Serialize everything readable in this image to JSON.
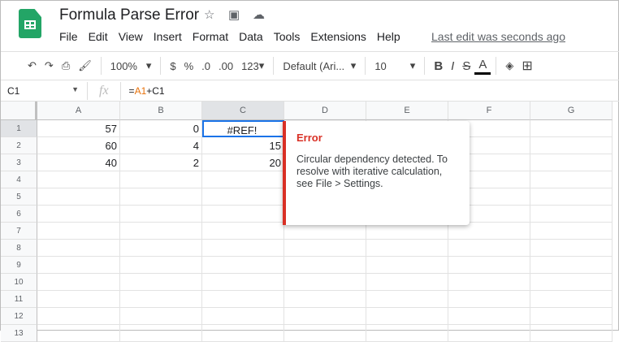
{
  "app": {
    "title": "Formula Parse Error",
    "last_edit": "Last edit was seconds ago"
  },
  "menu": [
    "File",
    "Edit",
    "View",
    "Insert",
    "Format",
    "Data",
    "Tools",
    "Extensions",
    "Help"
  ],
  "toolbar": {
    "zoom": "100%",
    "currency": "$",
    "percent": "%",
    "dec_less": ".0",
    "dec_more": ".00",
    "number_format": "123",
    "font": "Default (Ari...",
    "font_size": "10",
    "bold": "B",
    "italic": "I",
    "strike": "S",
    "text_color": "A"
  },
  "formula_bar": {
    "cell_ref": "C1",
    "fx": "fx",
    "formula_prefix": "=",
    "formula_ref1": "A1",
    "formula_rest": "+C1"
  },
  "columns": [
    "A",
    "B",
    "C",
    "D",
    "E",
    "F",
    "G"
  ],
  "rows": [
    "1",
    "2",
    "3",
    "4",
    "5",
    "6",
    "7",
    "8",
    "9",
    "10",
    "11",
    "12",
    "13"
  ],
  "cells": [
    [
      "57",
      "0",
      "#REF!"
    ],
    [
      "60",
      "4",
      "15"
    ],
    [
      "40",
      "2",
      "20"
    ]
  ],
  "error_popup": {
    "title": "Error",
    "message": "Circular dependency detected. To resolve with iterative calculation, see File > Settings."
  },
  "colors": {
    "accent": "#1a73e8",
    "error": "#d93025",
    "ref_orange": "#e8710a"
  }
}
